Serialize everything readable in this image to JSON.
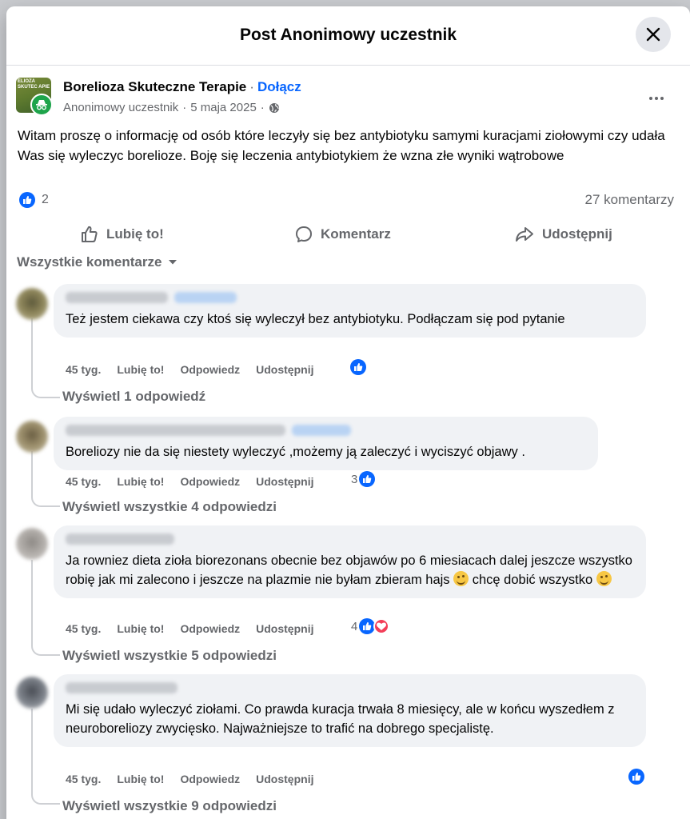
{
  "modal": {
    "title": "Post Anonimowy uczestnik"
  },
  "post": {
    "group_name": "Borelioza Skuteczne Terapie",
    "join_label": "Dołącz",
    "avatar_text": "ELIOZA SKUTEC APIE",
    "author": "Anonimowy uczestnik",
    "date": "5 maja 2025",
    "privacy_icon": "globe-icon",
    "text": "Witam proszę o informację od osób które leczyły się bez antybiotyku samymi kuracjami ziołowymi czy udała Was się wyleczyc borelioze. Boję się leczenia antybiotykiem że wzna złe wyniki wątrobowe",
    "like_count": "2",
    "comment_count": "27 komentarzy"
  },
  "actions": {
    "like": "Lubię to!",
    "comment": "Komentarz",
    "share": "Udostępnij"
  },
  "comments_filter": "Wszystkie komentarze",
  "comment_actions": {
    "time": "45 tyg.",
    "like": "Lubię to!",
    "reply": "Odpowiedz",
    "share": "Udostępnij"
  },
  "comments": [
    {
      "text": "Też jestem ciekawa czy ktoś się wyleczył bez antybiotyku. Podłączam się pod pytanie",
      "reaction_count": "",
      "replies": "Wyświetl 1 odpowiedź"
    },
    {
      "text": "Boreliozy nie da się niestety wyleczyć ,możemy ją zaleczyć i wyciszyć objawy .",
      "reaction_count": "3",
      "replies": "Wyświetl wszystkie 4 odpowiedzi"
    },
    {
      "text_a": "Ja rowniez dieta zioła biorezonans obecnie bez objawów po 6 miesiacach dalej jeszcze wszystko robię jak mi zalecono i jeszcze na plazmie nie byłam zbieram hajs ",
      "text_b": " chcę dobić wszystko ",
      "reaction_count": "4",
      "replies": "Wyświetl wszystkie 5 odpowiedzi"
    },
    {
      "text": "Mi się udało wyleczyć ziołami. Co prawda kuracja trwała 8 miesięcy, ale w końcu wyszedłem z neuroboreliozy zwycięsko. Najważniejsze to trafić na dobrego specjalistę.",
      "reaction_count": "",
      "replies": "Wyświetl wszystkie 9 odpowiedzi"
    }
  ]
}
